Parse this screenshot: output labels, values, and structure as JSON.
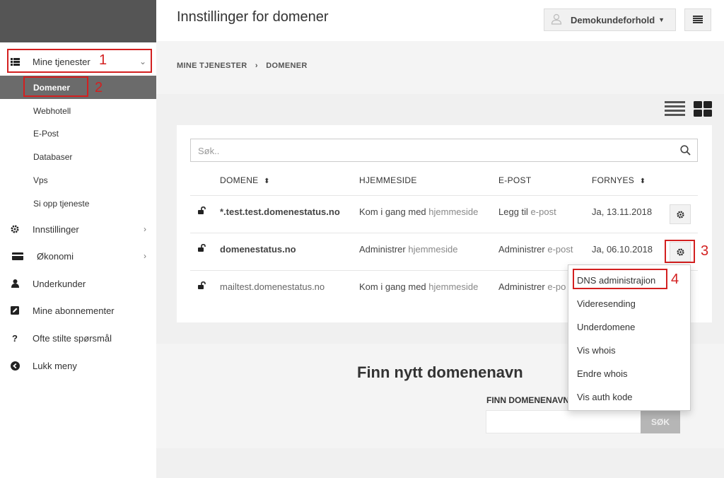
{
  "sidebar": {
    "menu": [
      {
        "label": "Mine tjenester"
      },
      {
        "label": "Innstillinger"
      },
      {
        "label": "Økonomi"
      },
      {
        "label": "Underkunder"
      },
      {
        "label": "Mine abonnementer"
      },
      {
        "label": "Ofte stilte spørsmål"
      },
      {
        "label": "Lukk meny"
      }
    ],
    "submenu": [
      {
        "label": "Domener"
      },
      {
        "label": "Webhotell"
      },
      {
        "label": "E-Post"
      },
      {
        "label": "Databaser"
      },
      {
        "label": "Vps"
      },
      {
        "label": "Si opp tjeneste"
      }
    ]
  },
  "header": {
    "title": "Innstillinger for domener",
    "account_label": "Demokundeforhold"
  },
  "breadcrumb": {
    "parent": "MINE TJENESTER",
    "separator": "›",
    "current": "DOMENER"
  },
  "table": {
    "search_placeholder": "Søk..",
    "headers": {
      "domain": "DOMENE",
      "website": "HJEMMESIDE",
      "email": "E-POST",
      "renews": "FORNYES"
    },
    "rows": [
      {
        "domain": "*.test.test.domenestatus.no",
        "web_action": "Kom i gang med",
        "web_suffix": "hjemmeside",
        "mail_action": "Legg til",
        "mail_suffix": "e-post",
        "renews": "Ja, 13.11.2018"
      },
      {
        "domain": "domenestatus.no",
        "web_action": "Administrer",
        "web_suffix": "hjemmeside",
        "mail_action": "Administrer",
        "mail_suffix": "e-post",
        "renews": "Ja, 06.10.2018"
      },
      {
        "domain": "mailtest.domenestatus.no",
        "web_action": "Kom i gang med",
        "web_suffix": "hjemmeside",
        "mail_action": "Administrer",
        "mail_suffix": "e-po",
        "renews": ""
      }
    ]
  },
  "dropdown": {
    "items": [
      "DNS administrajion",
      "Videresending",
      "Underdomene",
      "Vis whois",
      "Endre whois",
      "Vis auth kode"
    ]
  },
  "find_domain": {
    "title": "Finn nytt domenenavn",
    "label": "FINN DOMENENAVN",
    "button": "SØK"
  },
  "annotations": [
    "1",
    "2",
    "3",
    "4"
  ],
  "colors": {
    "annotation": "#d32020",
    "active_sub": "#6b6b6b",
    "sidebar_top": "#555555"
  }
}
